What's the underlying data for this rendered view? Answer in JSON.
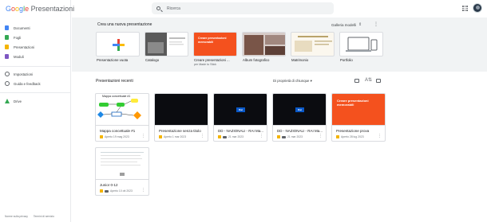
{
  "logo": {
    "brand": "Google",
    "product": "Presentazioni"
  },
  "sidebar": {
    "items": [
      {
        "label": "Documenti",
        "color": "#4285f4"
      },
      {
        "label": "Fogli",
        "color": "#34a853"
      },
      {
        "label": "Presentazioni",
        "color": "#f4b400"
      },
      {
        "label": "Moduli",
        "color": "#7e57c2"
      }
    ],
    "settings_label": "Impostazioni",
    "help_label": "Guida e feedback",
    "drive_label": "Drive",
    "footer_privacy": "Norme sulla privacy",
    "footer_terms": "Termini di servizio"
  },
  "search": {
    "placeholder": "Ricerca"
  },
  "templates": {
    "title": "Crea una nuova presentazione",
    "gallery_label": "Galleria modelli",
    "items": [
      {
        "label": "Presentazione vuota"
      },
      {
        "label": "Catalogo"
      },
      {
        "label": "Creare presentazioni ...",
        "sub": "per Made to Stick",
        "thumb_text": "Creare presentazioni memorabili"
      },
      {
        "label": "Album fotografico"
      },
      {
        "label": "Matrimonio"
      },
      {
        "label": "Portfolio"
      }
    ]
  },
  "recent": {
    "title": "Presentazioni recenti",
    "owner_filter": "Di proprietà di chiunque",
    "files": [
      {
        "title": "Mappa concettuale #1",
        "meta": "Aperto 19 mag 2023",
        "thumb_title": "Mappa concettuale #1"
      },
      {
        "title": "Presentazione senza titolo",
        "meta": "Aperto 1 mar 2023"
      },
      {
        "title": "DD - NAZIONALI - RAI Ma...",
        "meta": "21 mar 2023",
        "logo": "Rai"
      },
      {
        "title": "DD - NAZIONALI - RAI Ma...",
        "meta": "21 mar 2023",
        "logo": "Rai"
      },
      {
        "title": "Presentazione prova",
        "meta": "Aperto 28 lug 2023",
        "thumb_text": "Creare presentazioni memorabili"
      },
      {
        "title": "Junior 0-12",
        "meta": "Aperto 10 ott 2023"
      }
    ]
  }
}
